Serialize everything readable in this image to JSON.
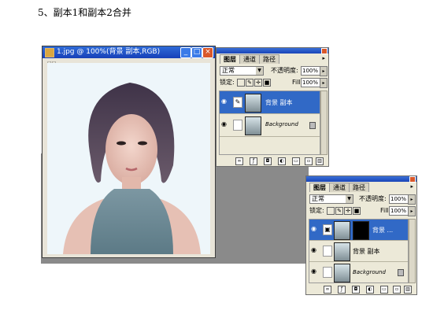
{
  "step_text": "5、副本1和副本2合并",
  "image_window": {
    "title": "1.jpg @ 100%(背景 副本,RGB)",
    "buttons": [
      "_",
      "□",
      "×"
    ]
  },
  "panel_top": {
    "tabs": [
      "图层",
      "通道",
      "路径"
    ],
    "blend_mode": "正常",
    "opacity_label": "不透明度:",
    "opacity_value": "100%",
    "lock_label": "锁定:",
    "fill_label": "Fill:",
    "fill_value": "100%",
    "layers": [
      {
        "name": "背景 副本",
        "selected": true
      },
      {
        "name": "Background",
        "selected": false
      }
    ],
    "menu_arrow": "▸"
  },
  "panel_bottom": {
    "tabs": [
      "图层",
      "通道",
      "路径"
    ],
    "blend_mode": "正常",
    "opacity_label": "不透明度:",
    "opacity_value": "100%",
    "lock_label": "锁定:",
    "fill_label": "Fill:",
    "fill_value": "100%",
    "layers": [
      {
        "name": "背景 ...",
        "selected": true
      },
      {
        "name": "背景 副本",
        "selected": false
      },
      {
        "name": "Background",
        "selected": false
      }
    ],
    "menu_arrow": "▸"
  },
  "icons": [
    "eye-icon",
    "brush-icon",
    "lock-icon",
    "link-icon",
    "mask-icon",
    "new-layer-icon",
    "trash-icon",
    "layer-style-icon",
    "adjustment-icon",
    "folder-icon"
  ]
}
